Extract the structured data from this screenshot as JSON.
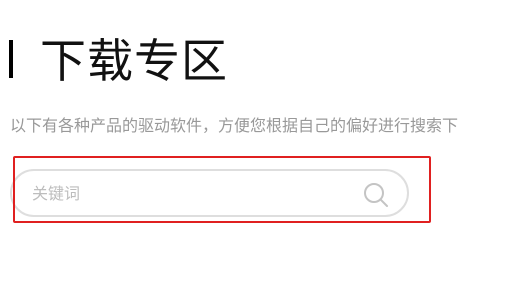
{
  "header": {
    "title": "下载专区",
    "subtitle": "以下有各种产品的驱动软件，方便您根据自己的偏好进行搜索下"
  },
  "search": {
    "placeholder": "关键词",
    "value": "",
    "icon": "search-icon"
  },
  "colors": {
    "highlight_border": "#e02020",
    "search_border": "#dedede",
    "subtitle_text": "#999999",
    "title_text": "#111111"
  }
}
